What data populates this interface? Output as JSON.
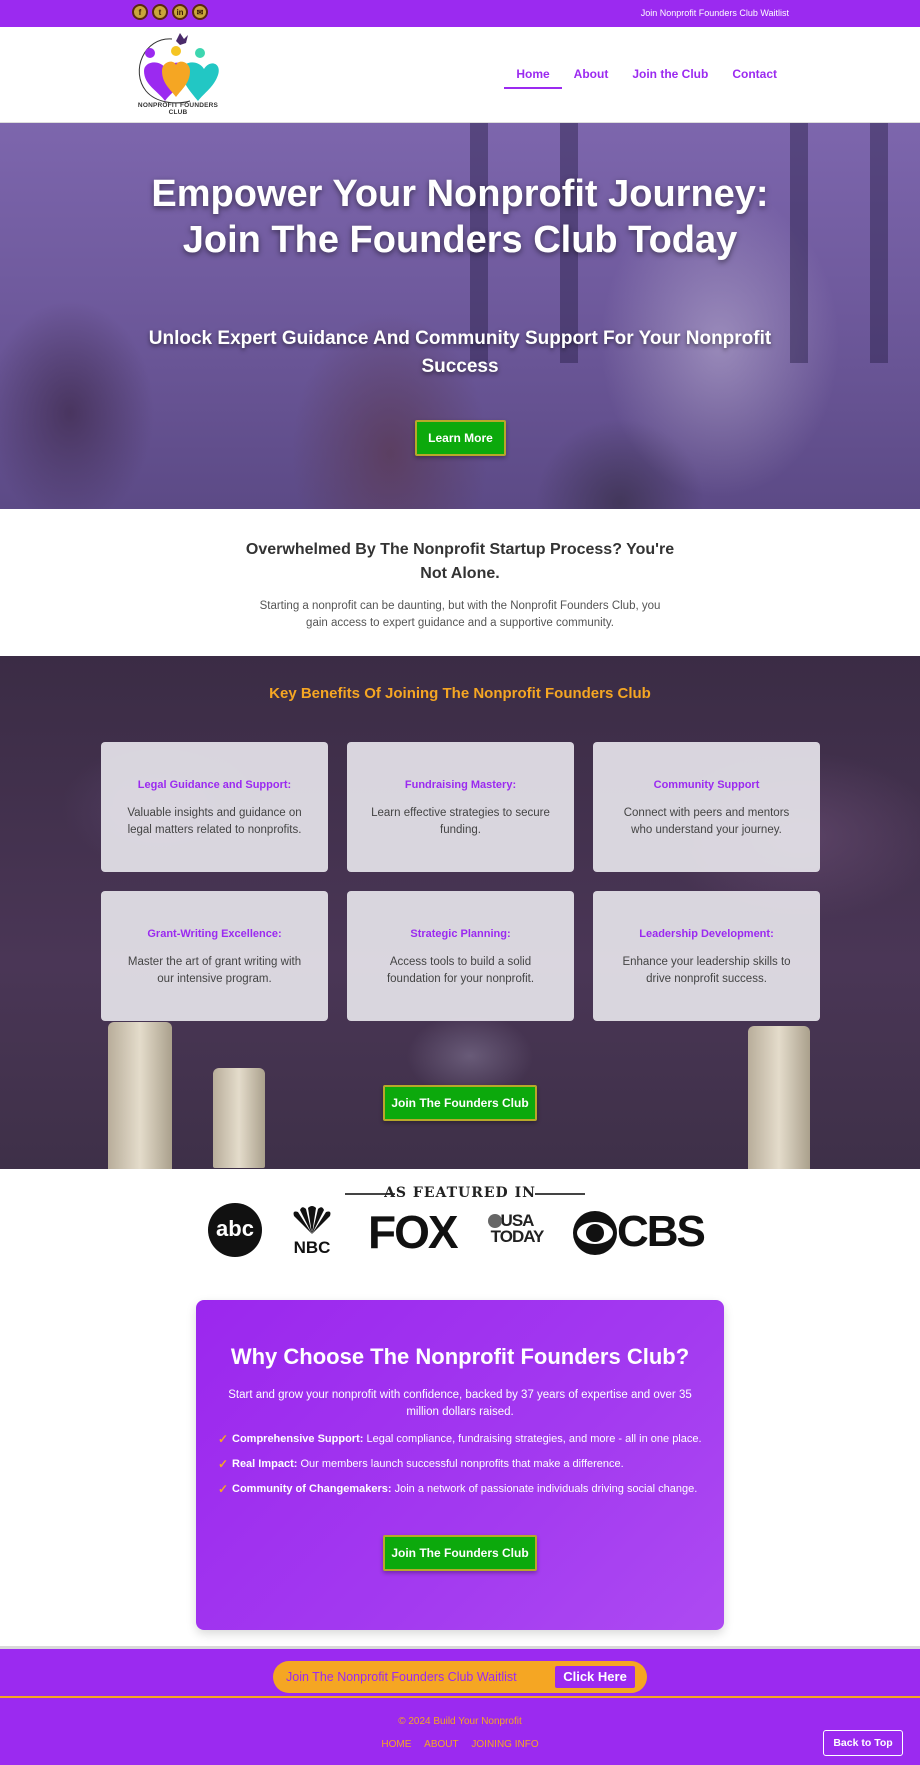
{
  "topbar": {
    "socials": [
      {
        "icon": "facebook-icon",
        "glyph": "f"
      },
      {
        "icon": "twitter-icon",
        "glyph": "t"
      },
      {
        "icon": "linkedin-icon",
        "glyph": "in"
      },
      {
        "icon": "email-icon",
        "glyph": "✉"
      }
    ],
    "waitlist_link": "Join Nonprofit Founders Club Waitlist"
  },
  "header": {
    "logo_text": "NONPROFIT FOUNDERS CLUB",
    "nav": [
      "Home",
      "About",
      "Join the Club",
      "Contact"
    ],
    "active_nav": "Home"
  },
  "hero": {
    "title": "Empower Your Nonprofit Journey: Join The Founders Club Today",
    "subtitle": "Unlock Expert Guidance And Community Support For Your Nonprofit Success",
    "button": "Learn More"
  },
  "intro": {
    "heading": "Overwhelmed By The Nonprofit Startup Process? You're Not Alone.",
    "body": "Starting a nonprofit can be daunting, but with the Nonprofit Founders Club, you gain access to expert guidance and a supportive community."
  },
  "benefits": {
    "heading": "Key Benefits Of Joining The Nonprofit Founders Club",
    "cards": [
      {
        "title": "Legal Guidance and Support:",
        "desc": "Valuable insights and guidance on legal matters related to nonprofits."
      },
      {
        "title": "Fundraising Mastery:",
        "desc": "Learn effective strategies to secure funding."
      },
      {
        "title": "Community Support",
        "desc": "Connect with peers and mentors who understand your journey."
      },
      {
        "title": "Grant-Writing Excellence:",
        "desc": "Master the art of grant writing with our intensive program."
      },
      {
        "title": "Strategic Planning:",
        "desc": "Access tools to build a solid foundation for your nonprofit."
      },
      {
        "title": "Leadership Development:",
        "desc": "Enhance your leadership skills to drive nonprofit success."
      }
    ],
    "button": "Join The Founders Club"
  },
  "featured": {
    "title": "AS FEATURED IN",
    "logos": {
      "abc": "abc",
      "nbc": "NBC",
      "fox": "FOX",
      "usa_today_1": "USA",
      "usa_today_2": "TODAY",
      "cbs": "CBS"
    }
  },
  "why": {
    "heading": "Why Choose The Nonprofit Founders Club?",
    "lead": "Start and grow your nonprofit with confidence, backed by 37 years of expertise and over 35 million dollars raised.",
    "points": [
      {
        "bold": "Comprehensive Support:",
        "text": " Legal compliance, fundraising strategies, and more - all in one place."
      },
      {
        "bold": "Real Impact:",
        "text": " Our members launch successful nonprofits that make a difference."
      },
      {
        "bold": "Community of Changemakers:",
        "text": " Join a network of passionate individuals driving social change."
      }
    ],
    "check": "✓",
    "button": "Join The Founders Club"
  },
  "waitlist_bar": {
    "text": "Join The Nonprofit Founders Club Waitlist",
    "button": "Click Here"
  },
  "footer": {
    "copyright": "© 2024 Build Your Nonprofit",
    "links": [
      "HOME",
      "ABOUT",
      "JOINING INFO"
    ],
    "back_to_top": "Back to Top"
  },
  "colors": {
    "brand_purple": "#9b2af0",
    "accent_orange": "#f5a623",
    "cta_green": "#0ca90c"
  }
}
